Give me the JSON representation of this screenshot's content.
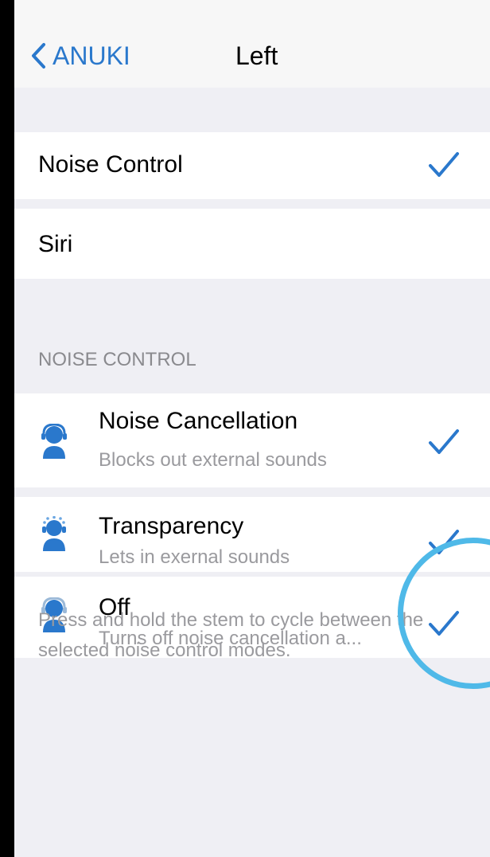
{
  "nav": {
    "back_label": "ANUKI",
    "title": "Left"
  },
  "press_options": [
    {
      "label": "Noise Control",
      "selected": true
    },
    {
      "label": "Siri",
      "selected": false
    }
  ],
  "noise_section": {
    "header": "NOISE CONTROL",
    "options": [
      {
        "title": "Noise Cancellation",
        "subtitle": "Blocks out external sounds",
        "icon": "noise-cancellation-icon",
        "checked": true
      },
      {
        "title": "Transparency",
        "subtitle": "Lets in exernal sounds",
        "icon": "transparency-icon",
        "checked": true
      },
      {
        "title": "Off",
        "subtitle": "Turns off noise cancellation a...",
        "icon": "noise-off-icon",
        "checked": true
      }
    ],
    "footer": "Press and hold the stem to cycle between the selected noise control modes."
  },
  "colors": {
    "accent": "#2a78cc",
    "highlight_ring": "#4fb9e8"
  }
}
